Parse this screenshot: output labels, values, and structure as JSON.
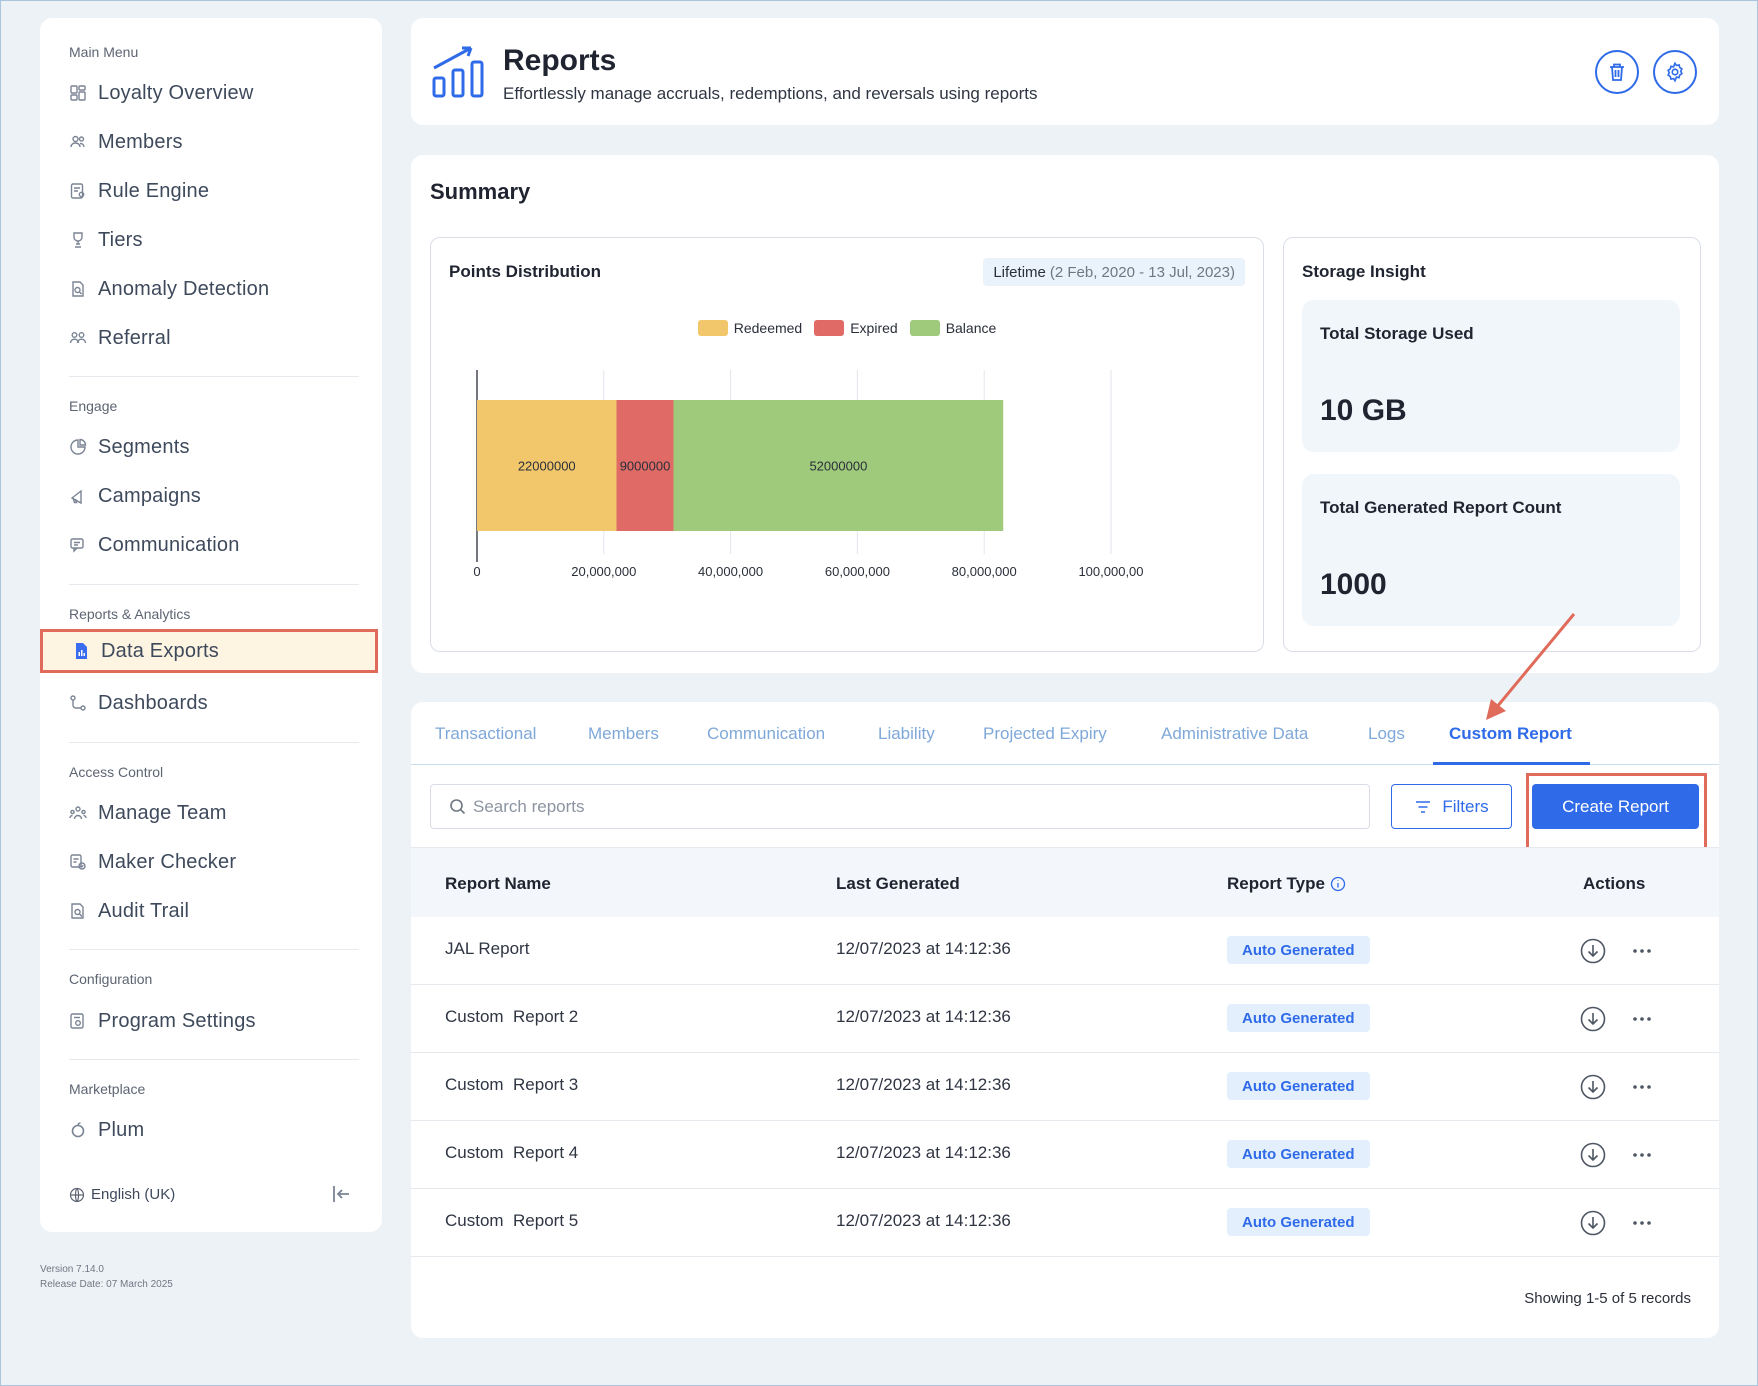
{
  "sidebar": {
    "sections": [
      {
        "title": "Main Menu",
        "items": [
          "Loyalty Overview",
          "Members",
          "Rule Engine",
          "Tiers",
          "Anomaly Detection",
          "Referral"
        ]
      },
      {
        "title": "Engage",
        "items": [
          "Segments",
          "Campaigns",
          "Communication"
        ]
      },
      {
        "title": "Reports & Analytics",
        "items": [
          "Data Exports",
          "Dashboards"
        ]
      },
      {
        "title": "Access Control",
        "items": [
          "Manage Team",
          "Maker Checker",
          "Audit Trail"
        ]
      },
      {
        "title": "Configuration",
        "items": [
          "Program Settings"
        ]
      },
      {
        "title": "Marketplace",
        "items": [
          "Plum"
        ]
      }
    ],
    "active_item": "Data Exports",
    "language": "English (UK)",
    "version": "Version 7.14.0",
    "release_date": "Release Date: 07 March 2025"
  },
  "header": {
    "title": "Reports",
    "subtitle": "Effortlessly manage accruals, redemptions, and reversals using reports"
  },
  "summary": {
    "title": "Summary",
    "points_distribution": {
      "title": "Points Distribution",
      "period_label": "Lifetime",
      "period_range": "(2 Feb, 2020 - 13 Jul, 2023)"
    },
    "storage": {
      "title": "Storage Insight",
      "total_storage_label": "Total Storage Used",
      "total_storage_value": "10 GB",
      "report_count_label": "Total Generated Report Count",
      "report_count_value": "1000"
    }
  },
  "chart_data": {
    "type": "bar",
    "orientation": "horizontal-stacked",
    "series": [
      {
        "name": "Redeemed",
        "values": [
          22000000
        ],
        "color": "#f2c76b"
      },
      {
        "name": "Expired",
        "values": [
          9000000
        ],
        "color": "#e06b66"
      },
      {
        "name": "Balance",
        "values": [
          52000000
        ],
        "color": "#9fc97b"
      }
    ],
    "x_ticks": [
      "0",
      "20,000,000",
      "40,000,000",
      "60,000,000",
      "80,000,000",
      "100,000,00"
    ],
    "xlim": [
      0,
      100000000
    ],
    "legend_position": "top-center",
    "grid": true
  },
  "reports": {
    "tabs": [
      "Transactional",
      "Members",
      "Communication",
      "Liability",
      "Projected Expiry",
      "Administrative Data",
      "Logs",
      "Custom Report"
    ],
    "active_tab": "Custom Report",
    "search_placeholder": "Search reports",
    "filters_label": "Filters",
    "create_label": "Create Report",
    "columns": [
      "Report Name",
      "Last Generated",
      "Report Type",
      "Actions"
    ],
    "rows": [
      {
        "name": "JAL Report",
        "last_generated": "12/07/2023 at 14:12:36",
        "type": "Auto Generated"
      },
      {
        "name": "Custom  Report 2",
        "last_generated": "12/07/2023 at 14:12:36",
        "type": "Auto Generated"
      },
      {
        "name": "Custom  Report 3",
        "last_generated": "12/07/2023 at 14:12:36",
        "type": "Auto Generated"
      },
      {
        "name": "Custom  Report 4",
        "last_generated": "12/07/2023 at 14:12:36",
        "type": "Auto Generated"
      },
      {
        "name": "Custom  Report 5",
        "last_generated": "12/07/2023 at 14:12:36",
        "type": "Auto Generated"
      }
    ],
    "records_text": "Showing 1-5 of 5 records"
  },
  "colors": {
    "accent": "#2f6be8",
    "annotation": "#e06b5a",
    "tab_inactive": "#7fa8d8"
  }
}
